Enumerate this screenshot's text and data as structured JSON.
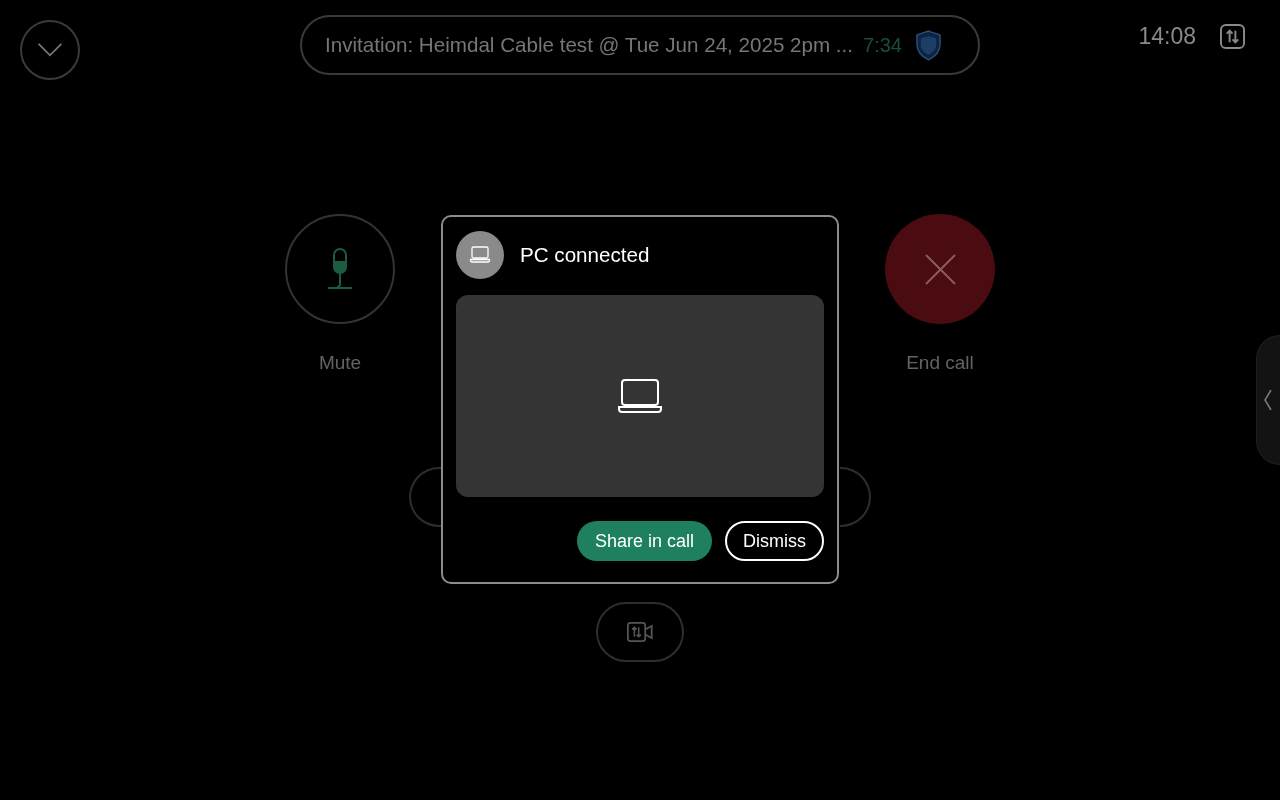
{
  "meeting_banner": {
    "title": "Invitation: Heimdal Cable test @ Tue Jun 24, 2025 2pm ...",
    "duration": "7:34"
  },
  "clock": "14:08",
  "call_controls": [
    {
      "kind": "mute",
      "label": "Mute"
    },
    {
      "kind": "end_call",
      "label": "End call"
    }
  ],
  "popup": {
    "title": "PC connected",
    "buttons": [
      {
        "kind": "primary",
        "label": "Share in call"
      },
      {
        "kind": "secondary",
        "label": "Dismiss"
      }
    ]
  }
}
